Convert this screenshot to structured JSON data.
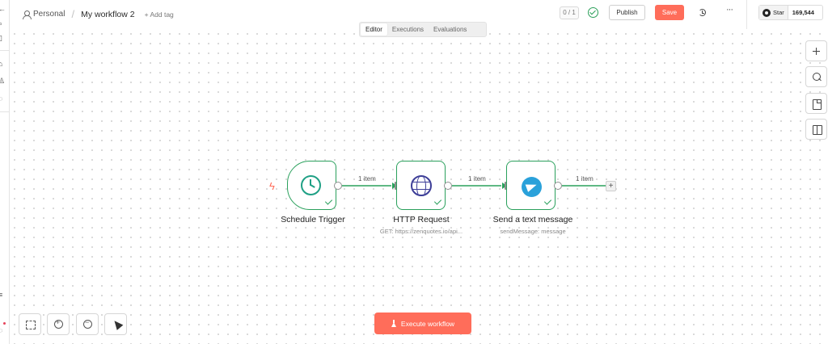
{
  "header": {
    "project": "Personal",
    "workflow_title": "My workflow 2",
    "add_tag": "+ Add tag",
    "counter": "0 / 1",
    "publish_label": "Publish",
    "save_label": "Save",
    "github_star_label": "Star",
    "github_star_count": "169,544"
  },
  "tabs": [
    {
      "label": "Editor",
      "active": true
    },
    {
      "label": "Executions",
      "active": false
    },
    {
      "label": "Evaluations",
      "active": false
    }
  ],
  "nodes": [
    {
      "name": "Schedule Trigger",
      "subtitle": "",
      "icon": "clock-icon"
    },
    {
      "name": "HTTP Request",
      "subtitle": "GET: https://zenquotes.io/api...",
      "icon": "globe-icon"
    },
    {
      "name": "Send a text message",
      "subtitle": "sendMessage: message",
      "icon": "telegram-icon"
    }
  ],
  "connections": [
    {
      "label": "1 item"
    },
    {
      "label": "1 item"
    },
    {
      "label": "1 item"
    }
  ],
  "execute_button": "Execute workflow",
  "right_toolbar": [
    "plus-icon",
    "search-icon",
    "sticky-note-icon",
    "panel-icon"
  ],
  "bottom_toolbar": [
    "fit-view-icon",
    "zoom-in-icon",
    "zoom-out-icon",
    "cursor-icon"
  ],
  "colors": {
    "accent": "#ff6d5a",
    "success": "#2aa05c",
    "telegram": "#2aa1da",
    "http_globe": "#3c3d97",
    "clock": "#1fa085"
  }
}
